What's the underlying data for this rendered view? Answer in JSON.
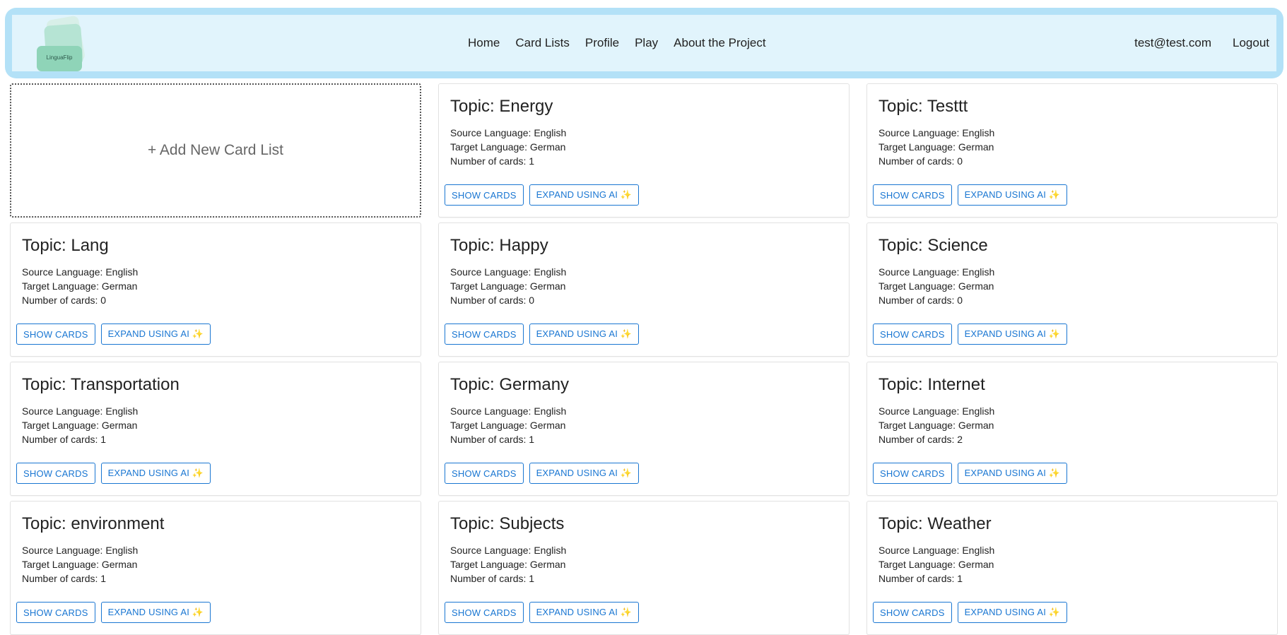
{
  "brand": {
    "logo_text": "LinguaFlip"
  },
  "nav": {
    "links": [
      "Home",
      "Card Lists",
      "Profile",
      "Play",
      "About the Project"
    ],
    "user_email": "test@test.com",
    "logout_label": "Logout"
  },
  "add_card": {
    "label": "+ Add New Card List"
  },
  "labels": {
    "source_language": "Source Language: ",
    "target_language": "Target Language: ",
    "number_of_cards": "Number of cards: ",
    "show_cards": "SHOW CARDS",
    "expand_ai": "EXPAND USING AI ✨"
  },
  "card_lists": [
    {
      "title": "Topic: Energy",
      "source": "English",
      "target": "German",
      "count": "1"
    },
    {
      "title": "Topic: Testtt",
      "source": "English",
      "target": "German",
      "count": "0"
    },
    {
      "title": "Topic: Lang",
      "source": "English",
      "target": "German",
      "count": "0"
    },
    {
      "title": "Topic: Happy",
      "source": "English",
      "target": "German",
      "count": "0"
    },
    {
      "title": "Topic: Science",
      "source": "English",
      "target": "German",
      "count": "0"
    },
    {
      "title": "Topic: Transportation",
      "source": "English",
      "target": "German",
      "count": "1"
    },
    {
      "title": "Topic: Germany",
      "source": "English",
      "target": "German",
      "count": "1"
    },
    {
      "title": "Topic: Internet",
      "source": "English",
      "target": "German",
      "count": "2"
    },
    {
      "title": "Topic: environment",
      "source": "English",
      "target": "German",
      "count": "1"
    },
    {
      "title": "Topic: Subjects",
      "source": "English",
      "target": "German",
      "count": "1"
    },
    {
      "title": "Topic: Weather",
      "source": "English",
      "target": "German",
      "count": "1"
    }
  ]
}
